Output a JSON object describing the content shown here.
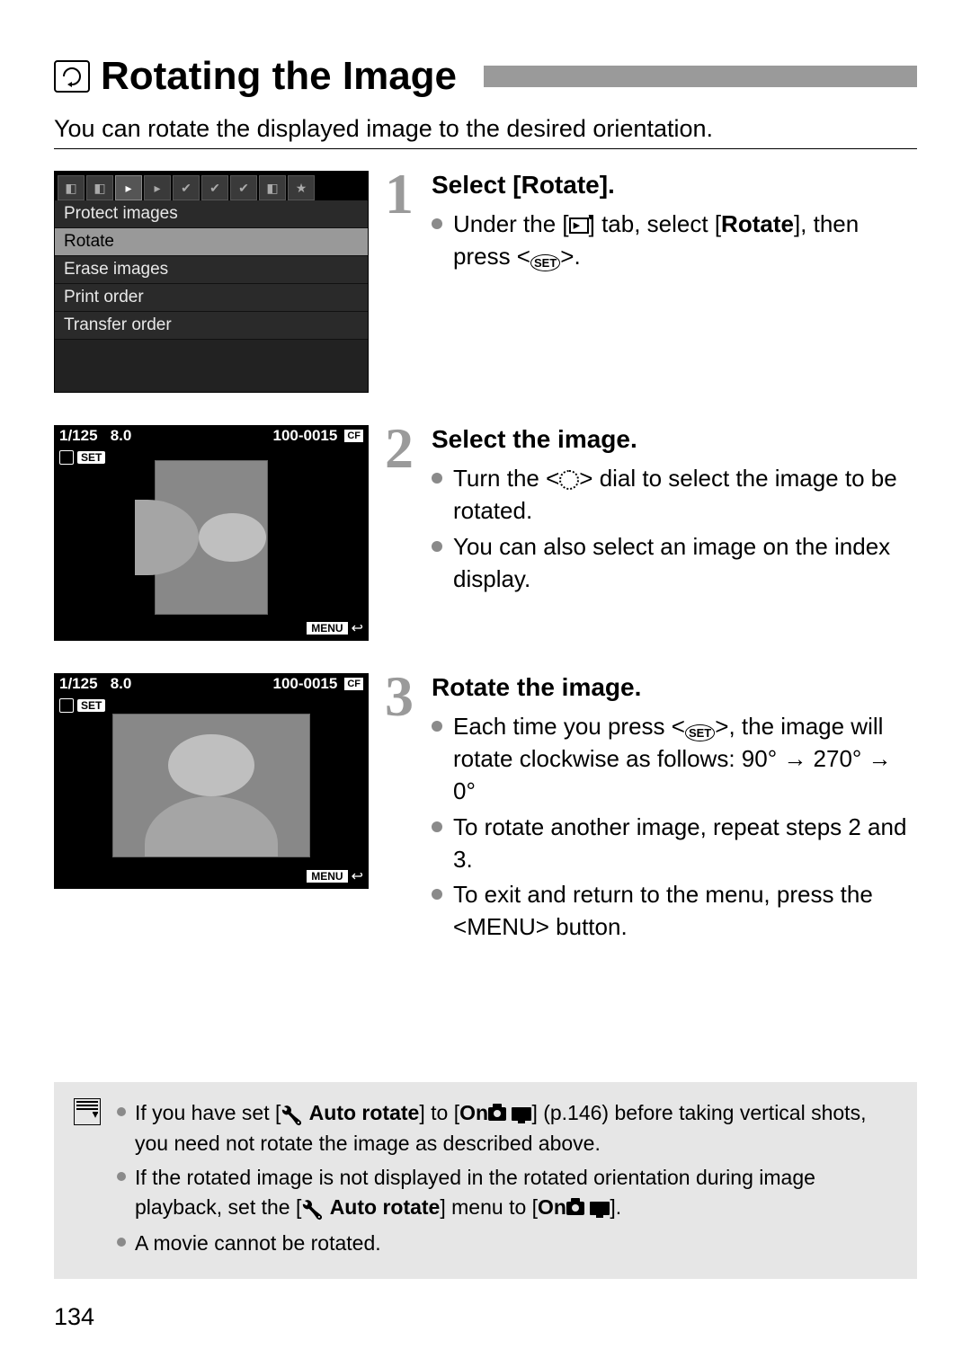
{
  "title": "Rotating the Image",
  "intro": "You can rotate the displayed image to the desired orientation.",
  "menu": {
    "items": [
      "Protect images",
      "Rotate",
      "Erase images",
      "Print order",
      "Transfer order"
    ],
    "selected_index": 1
  },
  "preview": {
    "shutter": "1/125",
    "aperture": "8.0",
    "file_no": "100-0015",
    "set_label": "SET",
    "menu_label": "MENU"
  },
  "steps": [
    {
      "num": "1",
      "title": "Select [Rotate].",
      "bullets": [
        {
          "pre": "Under the [",
          "mid_icon": "playback-tab",
          "post1": "] tab, select [",
          "bold": "Rotate",
          "post2": "], then press <",
          "end_icon": "set",
          "post3": ">."
        }
      ]
    },
    {
      "num": "2",
      "title": "Select the image.",
      "bullets": [
        {
          "pre": "Turn the <",
          "mid_icon": "dial",
          "post1": "> dial to select the image to be rotated."
        },
        {
          "text": "You can also select an image on the index display."
        }
      ]
    },
    {
      "num": "3",
      "title": "Rotate the image.",
      "bullets": [
        {
          "pre": "Each time you press <",
          "mid_icon": "set",
          "post1": ">, the image will rotate clockwise as follows: 90° → 270° → 0°"
        },
        {
          "text": "To rotate another image, repeat steps 2 and 3."
        },
        {
          "pre": "To exit and return to the menu, press the <",
          "mid_text": "MENU",
          "post1": "> button."
        }
      ]
    }
  ],
  "notes": {
    "items": [
      {
        "parts": [
          "If you have set [",
          {
            "icon": "wrench"
          },
          " ",
          {
            "bold": "Auto rotate"
          },
          "] to [",
          {
            "bold": "On"
          },
          {
            "icon": "cam"
          },
          " ",
          {
            "icon": "screen"
          },
          "] (p.146) before taking vertical shots, you need not rotate the image as described above."
        ]
      },
      {
        "parts": [
          "If the rotated image is not displayed in the rotated orientation during image playback, set the [",
          {
            "icon": "wrench"
          },
          " ",
          {
            "bold": "Auto rotate"
          },
          "] menu to [",
          {
            "bold": "On"
          },
          {
            "icon": "cam"
          },
          " ",
          {
            "icon": "screen"
          },
          "]."
        ]
      },
      {
        "parts": [
          "A movie cannot be rotated."
        ]
      }
    ]
  },
  "page_number": "134"
}
